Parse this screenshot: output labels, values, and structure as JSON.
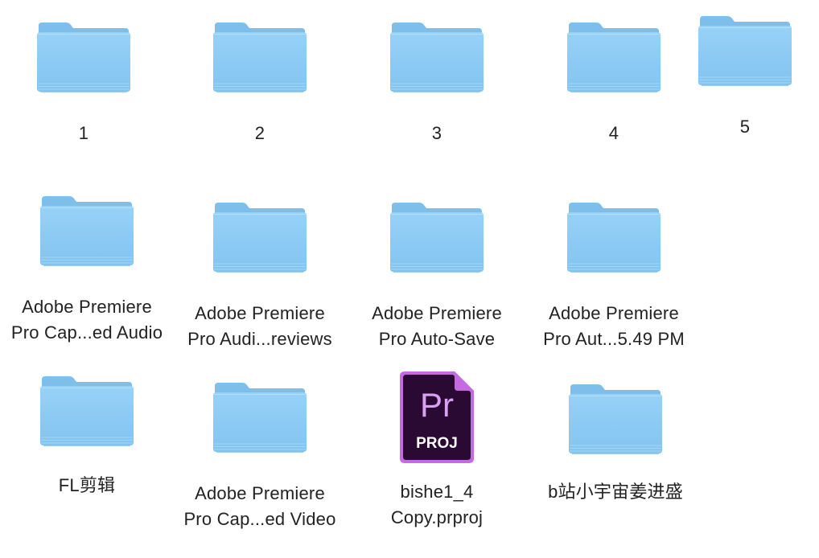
{
  "window": {
    "background": "#ffffff"
  },
  "colors": {
    "folder_tab": "#8ec7ef",
    "folder_body_top": "#94cff6",
    "folder_body_bottom": "#7cc0ee",
    "folder_edge": "#6eaedb",
    "premiere_bg": "#2a0a33",
    "premiere_border": "#c56ae0",
    "premiere_text": "#d9a1f2"
  },
  "items": [
    {
      "name": "1",
      "icon": "folder-icon"
    },
    {
      "name": "2",
      "icon": "folder-icon"
    },
    {
      "name": "3",
      "icon": "folder-icon"
    },
    {
      "name": "4",
      "icon": "folder-icon"
    },
    {
      "name": "5",
      "icon": "folder-icon"
    },
    {
      "name": "Adobe Premiere\nPro Cap...ed Audio",
      "icon": "folder-icon"
    },
    {
      "name": "Adobe Premiere\nPro Audi...reviews",
      "icon": "folder-icon"
    },
    {
      "name": "Adobe Premiere\nPro Auto-Save",
      "icon": "folder-icon"
    },
    {
      "name": "Adobe Premiere\nPro Aut...5.49 PM",
      "icon": "folder-icon"
    },
    {
      "name": "FL剪辑",
      "icon": "folder-icon"
    },
    {
      "name": "Adobe Premiere\nPro Cap...ed Video",
      "icon": "folder-icon"
    },
    {
      "name": "bishe1_4\nCopy.prproj",
      "icon": "premiere-project-icon",
      "badge_text": "Pr",
      "badge_sub": "PROJ"
    },
    {
      "name": "b站小宇宙姜进盛",
      "icon": "folder-icon"
    }
  ]
}
